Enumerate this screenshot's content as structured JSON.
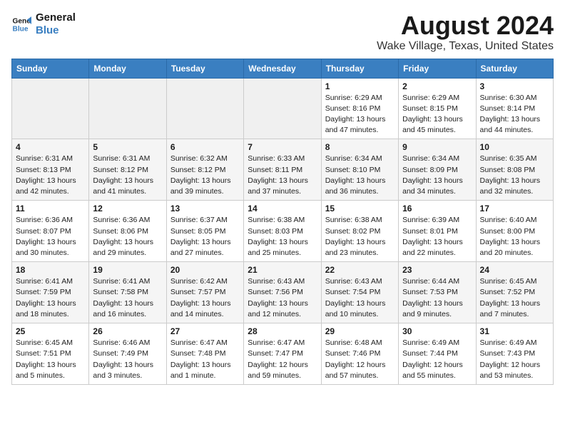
{
  "logo": {
    "line1": "General",
    "line2": "Blue"
  },
  "title": "August 2024",
  "subtitle": "Wake Village, Texas, United States",
  "weekdays": [
    "Sunday",
    "Monday",
    "Tuesday",
    "Wednesday",
    "Thursday",
    "Friday",
    "Saturday"
  ],
  "weeks": [
    [
      {
        "num": "",
        "detail": ""
      },
      {
        "num": "",
        "detail": ""
      },
      {
        "num": "",
        "detail": ""
      },
      {
        "num": "",
        "detail": ""
      },
      {
        "num": "1",
        "detail": "Sunrise: 6:29 AM\nSunset: 8:16 PM\nDaylight: 13 hours\nand 47 minutes."
      },
      {
        "num": "2",
        "detail": "Sunrise: 6:29 AM\nSunset: 8:15 PM\nDaylight: 13 hours\nand 45 minutes."
      },
      {
        "num": "3",
        "detail": "Sunrise: 6:30 AM\nSunset: 8:14 PM\nDaylight: 13 hours\nand 44 minutes."
      }
    ],
    [
      {
        "num": "4",
        "detail": "Sunrise: 6:31 AM\nSunset: 8:13 PM\nDaylight: 13 hours\nand 42 minutes."
      },
      {
        "num": "5",
        "detail": "Sunrise: 6:31 AM\nSunset: 8:12 PM\nDaylight: 13 hours\nand 41 minutes."
      },
      {
        "num": "6",
        "detail": "Sunrise: 6:32 AM\nSunset: 8:12 PM\nDaylight: 13 hours\nand 39 minutes."
      },
      {
        "num": "7",
        "detail": "Sunrise: 6:33 AM\nSunset: 8:11 PM\nDaylight: 13 hours\nand 37 minutes."
      },
      {
        "num": "8",
        "detail": "Sunrise: 6:34 AM\nSunset: 8:10 PM\nDaylight: 13 hours\nand 36 minutes."
      },
      {
        "num": "9",
        "detail": "Sunrise: 6:34 AM\nSunset: 8:09 PM\nDaylight: 13 hours\nand 34 minutes."
      },
      {
        "num": "10",
        "detail": "Sunrise: 6:35 AM\nSunset: 8:08 PM\nDaylight: 13 hours\nand 32 minutes."
      }
    ],
    [
      {
        "num": "11",
        "detail": "Sunrise: 6:36 AM\nSunset: 8:07 PM\nDaylight: 13 hours\nand 30 minutes."
      },
      {
        "num": "12",
        "detail": "Sunrise: 6:36 AM\nSunset: 8:06 PM\nDaylight: 13 hours\nand 29 minutes."
      },
      {
        "num": "13",
        "detail": "Sunrise: 6:37 AM\nSunset: 8:05 PM\nDaylight: 13 hours\nand 27 minutes."
      },
      {
        "num": "14",
        "detail": "Sunrise: 6:38 AM\nSunset: 8:03 PM\nDaylight: 13 hours\nand 25 minutes."
      },
      {
        "num": "15",
        "detail": "Sunrise: 6:38 AM\nSunset: 8:02 PM\nDaylight: 13 hours\nand 23 minutes."
      },
      {
        "num": "16",
        "detail": "Sunrise: 6:39 AM\nSunset: 8:01 PM\nDaylight: 13 hours\nand 22 minutes."
      },
      {
        "num": "17",
        "detail": "Sunrise: 6:40 AM\nSunset: 8:00 PM\nDaylight: 13 hours\nand 20 minutes."
      }
    ],
    [
      {
        "num": "18",
        "detail": "Sunrise: 6:41 AM\nSunset: 7:59 PM\nDaylight: 13 hours\nand 18 minutes."
      },
      {
        "num": "19",
        "detail": "Sunrise: 6:41 AM\nSunset: 7:58 PM\nDaylight: 13 hours\nand 16 minutes."
      },
      {
        "num": "20",
        "detail": "Sunrise: 6:42 AM\nSunset: 7:57 PM\nDaylight: 13 hours\nand 14 minutes."
      },
      {
        "num": "21",
        "detail": "Sunrise: 6:43 AM\nSunset: 7:56 PM\nDaylight: 13 hours\nand 12 minutes."
      },
      {
        "num": "22",
        "detail": "Sunrise: 6:43 AM\nSunset: 7:54 PM\nDaylight: 13 hours\nand 10 minutes."
      },
      {
        "num": "23",
        "detail": "Sunrise: 6:44 AM\nSunset: 7:53 PM\nDaylight: 13 hours\nand 9 minutes."
      },
      {
        "num": "24",
        "detail": "Sunrise: 6:45 AM\nSunset: 7:52 PM\nDaylight: 13 hours\nand 7 minutes."
      }
    ],
    [
      {
        "num": "25",
        "detail": "Sunrise: 6:45 AM\nSunset: 7:51 PM\nDaylight: 13 hours\nand 5 minutes."
      },
      {
        "num": "26",
        "detail": "Sunrise: 6:46 AM\nSunset: 7:49 PM\nDaylight: 13 hours\nand 3 minutes."
      },
      {
        "num": "27",
        "detail": "Sunrise: 6:47 AM\nSunset: 7:48 PM\nDaylight: 13 hours\nand 1 minute."
      },
      {
        "num": "28",
        "detail": "Sunrise: 6:47 AM\nSunset: 7:47 PM\nDaylight: 12 hours\nand 59 minutes."
      },
      {
        "num": "29",
        "detail": "Sunrise: 6:48 AM\nSunset: 7:46 PM\nDaylight: 12 hours\nand 57 minutes."
      },
      {
        "num": "30",
        "detail": "Sunrise: 6:49 AM\nSunset: 7:44 PM\nDaylight: 12 hours\nand 55 minutes."
      },
      {
        "num": "31",
        "detail": "Sunrise: 6:49 AM\nSunset: 7:43 PM\nDaylight: 12 hours\nand 53 minutes."
      }
    ]
  ]
}
